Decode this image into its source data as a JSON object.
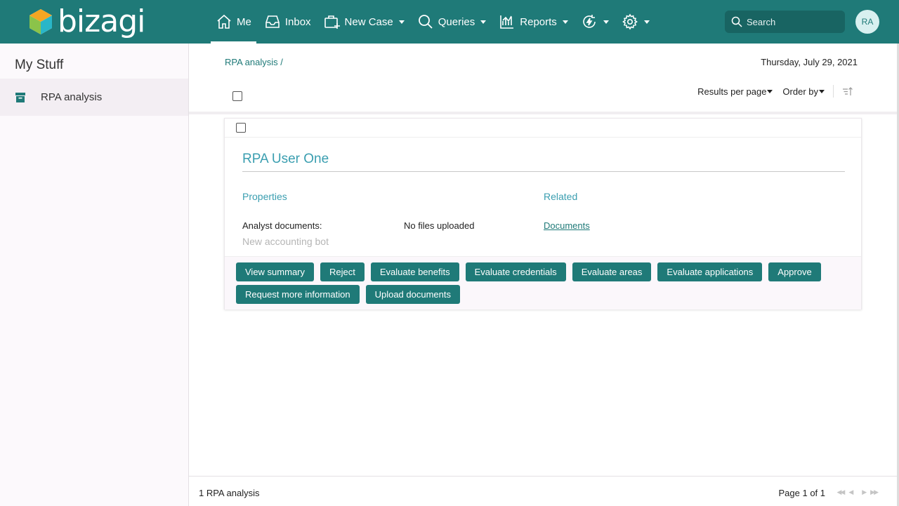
{
  "app": {
    "logo_text": "bizagi",
    "brand_color": "#1f7a78"
  },
  "nav": {
    "items": [
      {
        "label": "Me",
        "icon": "home-icon",
        "active": true
      },
      {
        "label": "Inbox",
        "icon": "inbox-icon"
      },
      {
        "label": "New Case",
        "icon": "new-case-icon"
      },
      {
        "label": "Queries",
        "icon": "search-icon"
      },
      {
        "label": "Reports",
        "icon": "reports-icon"
      }
    ],
    "search_placeholder": "Search",
    "avatar_initials": "RA"
  },
  "sidebar": {
    "title": "My Stuff",
    "items": [
      {
        "label": "RPA analysis",
        "icon": "archive-icon"
      }
    ]
  },
  "main": {
    "breadcrumb": "RPA analysis /",
    "date": "Thursday, July 29, 2021",
    "toolbar": {
      "results_per_page": "Results per page",
      "order_by": "Order by"
    },
    "card": {
      "title": "RPA User One",
      "properties_heading": "Properties",
      "related_heading": "Related",
      "field_label": "Analyst documents:",
      "field_value": "No files uploaded",
      "field_sub": "New accounting bot",
      "related_link": "Documents",
      "actions": [
        "View summary",
        "Reject",
        "Evaluate benefits",
        "Evaluate credentials",
        "Evaluate areas",
        "Evaluate applications",
        "Approve",
        "Request more information",
        "Upload documents"
      ]
    },
    "footer": {
      "count": "1 RPA analysis",
      "page": "Page 1 of 1"
    }
  }
}
